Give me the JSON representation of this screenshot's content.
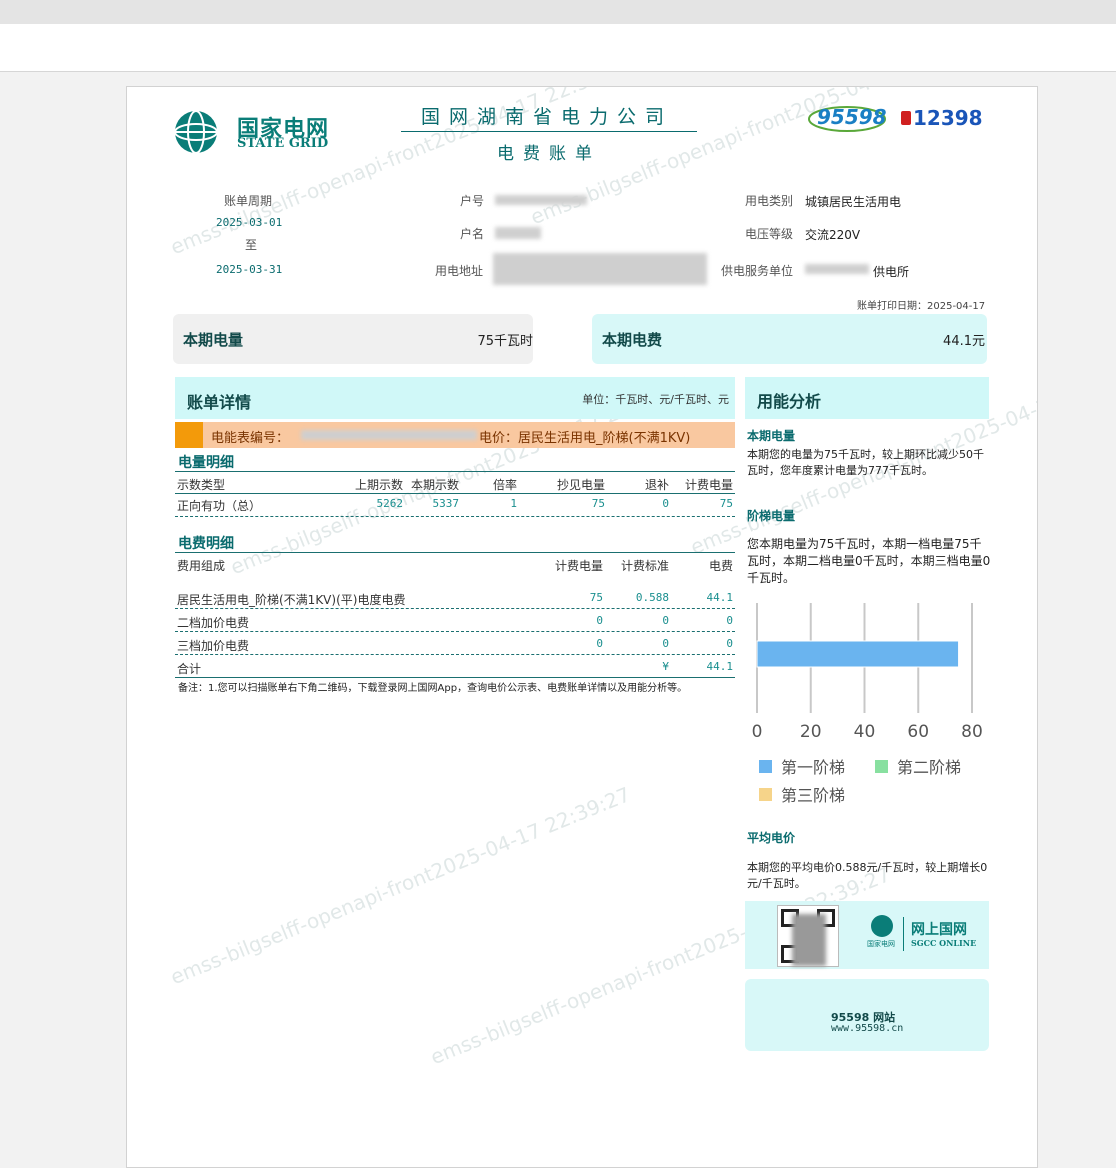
{
  "header": {
    "logo_cn": "国家电网",
    "logo_en": "STATE GRID",
    "company": "国网湖南省电力公司",
    "bill_title": "电费账单",
    "hotline_95598": "95598",
    "hotline_12398": "12398"
  },
  "info": {
    "period_label": "账单周期",
    "period_start": "2025-03-01",
    "period_to": "至",
    "period_end": "2025-03-31",
    "account_label": "户号",
    "name_label": "户名",
    "address_label": "用电地址",
    "usage_type_label": "用电类别",
    "usage_type_value": "城镇居民生活用电",
    "voltage_label": "电压等级",
    "voltage_value": "交流220V",
    "supplier_label": "供电服务单位",
    "supplier_value": "供电所",
    "print_date": "账单打印日期：2025-04-17"
  },
  "summary": {
    "usage_label": "本期电量",
    "usage_value": "75千瓦时",
    "fee_label": "本期电费",
    "fee_value": "44.1元"
  },
  "detail": {
    "title": "账单详情",
    "unit": "单位：千瓦时、元/千瓦时、元",
    "meter_line_prefix": "电能表编号：",
    "meter_line_suffix": "电价：居民生活用电_阶梯(不满1KV)",
    "usage_section": "电量明细",
    "usage_headers": [
      "示数类型",
      "上期示数",
      "本期示数",
      "倍率",
      "抄见电量",
      "退补",
      "计费电量"
    ],
    "usage_rows": [
      [
        "正向有功（总）",
        "5262",
        "5337",
        "1",
        "75",
        "0",
        "75"
      ]
    ],
    "fee_section": "电费明细",
    "fee_headers": [
      "费用组成",
      "计费电量",
      "计费标准",
      "电费"
    ],
    "fee_rows": [
      [
        "居民生活用电_阶梯(不满1KV)(平)电度电费",
        "75",
        "0.588",
        "44.1"
      ],
      [
        "二档加价电费",
        "0",
        "0",
        "0"
      ],
      [
        "三档加价电费",
        "0",
        "0",
        "0"
      ],
      [
        "合计",
        "",
        "¥",
        "44.1"
      ]
    ],
    "note": "备注：1.您可以扫描账单右下角二维码，下载登录网上国网App，查询电价公示表、电费账单详情以及用能分析等。"
  },
  "analysis": {
    "title": "用能分析",
    "period_usage_title": "本期电量",
    "period_usage_text": "本期您的电量为75千瓦时，较上期环比减少50千瓦时，您年度累计电量为777千瓦时。",
    "tier_title": "阶梯电量",
    "tier_text": "您本期电量为75千瓦时，本期一档电量75千瓦时，本期二档电量0千瓦时，本期三档电量0千瓦时。",
    "avg_title": "平均电价",
    "avg_text": "本期您的平均电价0.588元/千瓦时，较上期增长0元/千瓦时。"
  },
  "chart_data": {
    "type": "bar",
    "orientation": "horizontal",
    "categories": [
      ""
    ],
    "series": [
      {
        "name": "第一阶梯",
        "values": [
          75
        ],
        "color": "#6ab4ef"
      },
      {
        "name": "第二阶梯",
        "values": [
          0
        ],
        "color": "#88e0a0"
      },
      {
        "name": "第三阶梯",
        "values": [
          0
        ],
        "color": "#f6d48a"
      }
    ],
    "xlim": [
      0,
      80
    ],
    "xticks": [
      "0",
      "20",
      "40",
      "60",
      "80"
    ],
    "grid": true,
    "legend": "bottom"
  },
  "footer": {
    "app_cn": "网上国网",
    "app_en": "SGCC ONLINE",
    "logo_small": "国家电网",
    "site_title": "95598 网站",
    "site_url": "www.95598.cn"
  },
  "watermark": "emss-bilgselff-openapi-front2025-04-17 22:39:27"
}
